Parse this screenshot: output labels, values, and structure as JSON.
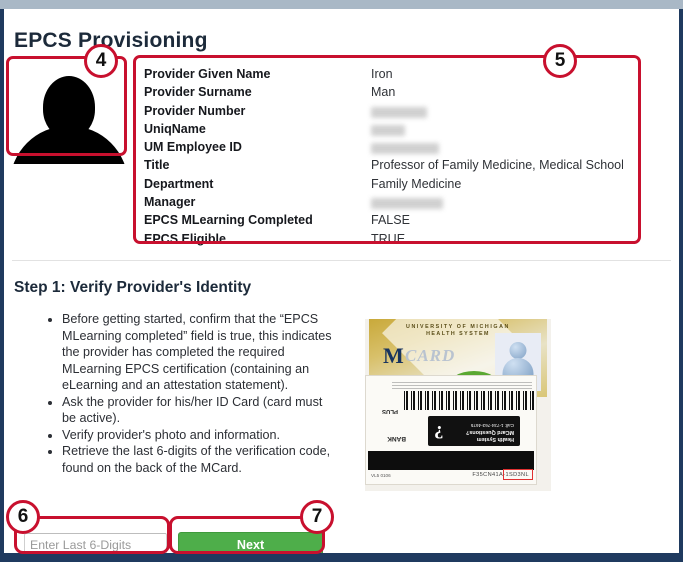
{
  "page": {
    "title": "EPCS Provisioning",
    "step_title": "Step 1: Verify Provider's Identity"
  },
  "provider": {
    "photo_alt": "provider-photo-silhouette",
    "fields": [
      {
        "label": "Provider Given Name",
        "value": "Iron",
        "redacted": false
      },
      {
        "label": "Provider Surname",
        "value": "Man",
        "redacted": false
      },
      {
        "label": "Provider Number",
        "value": "",
        "redacted": true,
        "redact_width": 56
      },
      {
        "label": "UniqName",
        "value": "",
        "redacted": true,
        "redact_width": 34
      },
      {
        "label": "UM Employee ID",
        "value": "",
        "redacted": true,
        "redact_width": 68
      },
      {
        "label": "Title",
        "value": "Professor of Family Medicine, Medical School",
        "redacted": false
      },
      {
        "label": "Department",
        "value": "Family Medicine",
        "redacted": false
      },
      {
        "label": "Manager",
        "value": "",
        "redacted": true,
        "redact_width": 72
      },
      {
        "label": "EPCS MLearning Completed",
        "value": "FALSE",
        "redacted": false
      },
      {
        "label": "EPCS Eligible",
        "value": "TRUE",
        "redacted": false
      }
    ]
  },
  "instructions": {
    "bullets": [
      "Before getting started, confirm that the “EPCS MLearning completed” field is true, this indicates the provider has completed the required MLearning EPCS certification (containing an eLearning and an attestation statement).",
      "Ask the provider for his/her ID Card (card must be active).",
      "Verify provider's photo and information.",
      "Retrieve the last 6-digits of the verification code, found on the back of the MCard."
    ]
  },
  "mcard": {
    "front": {
      "line1": "UNIVERSITY OF MICHIGAN",
      "line2": "HEALTH SYSTEM",
      "logo_m": "M",
      "logo_card": "CARD"
    },
    "back": {
      "help_line1": "Health System",
      "help_line2": "MCard Questions?",
      "help_line3": "Call: 1-734-763-4675",
      "help_mark": "?",
      "logo_small": "PLUS",
      "logo_bank": "BANK",
      "small_left": "VL5 0106",
      "code_text": "F35CN41A-1SD3NL"
    }
  },
  "controls": {
    "code_input_placeholder": "Enter Last 6-Digits",
    "code_input_value": "",
    "next_label": "Next"
  },
  "annotations": {
    "num4": "4",
    "num5": "5",
    "num6": "6",
    "num7": "7"
  },
  "colors": {
    "annotation_red": "#c8102e",
    "next_green": "#4eae4a",
    "title_navy": "#1c2a3a"
  }
}
